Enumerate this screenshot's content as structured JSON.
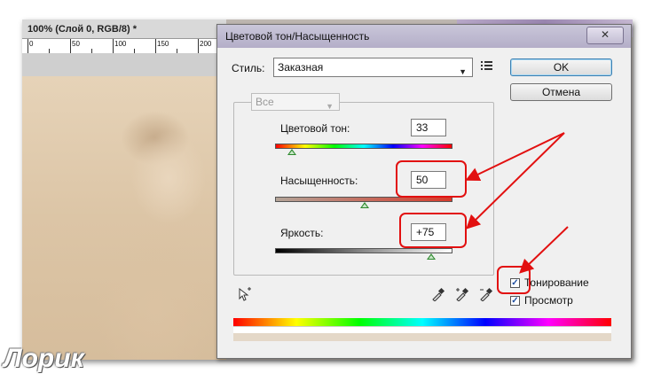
{
  "document": {
    "tab_title": "100% (Слой 0, RGB/8) *",
    "ruler_marks": [
      "0",
      "50",
      "100",
      "150",
      "200"
    ]
  },
  "dialog": {
    "title": "Цветовой тон/Насыщенность",
    "close_symbol": "✕",
    "preset": {
      "label": "Стиль:",
      "value": "Заказная"
    },
    "edit_channel": {
      "value": "Все"
    },
    "hue": {
      "label": "Цветовой тон:",
      "value": "33"
    },
    "saturation": {
      "label": "Насыщенность:",
      "value": "50"
    },
    "lightness": {
      "label": "Яркость:",
      "value": "+75"
    },
    "ok_label": "OK",
    "cancel_label": "Отмена",
    "colorize": {
      "label": "Тонирование",
      "checked": true
    },
    "preview": {
      "label": "Просмотр",
      "checked": true
    }
  },
  "watermark": "Лорик",
  "colors": {
    "annotation": "#e21010",
    "thumb": "#2f8a2f"
  }
}
